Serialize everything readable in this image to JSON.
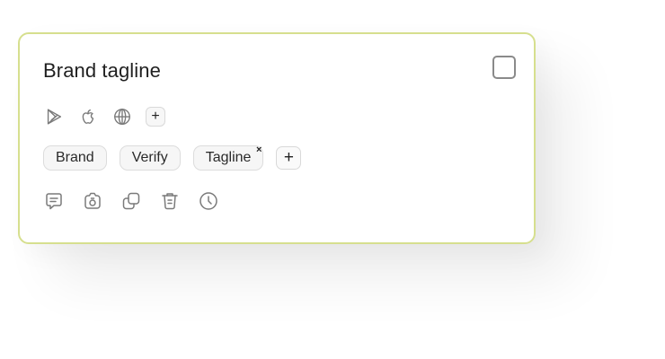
{
  "card": {
    "title": "Brand tagline",
    "border_color": "#d6df8e"
  },
  "platforms": [
    {
      "icon": "google-play-icon"
    },
    {
      "icon": "apple-icon"
    },
    {
      "icon": "globe-icon"
    }
  ],
  "platform_add_label": "+",
  "tags": [
    {
      "label": "Brand"
    },
    {
      "label": "Verify"
    },
    {
      "label": "Tagline",
      "remove_label": "×"
    }
  ],
  "tag_add_label": "+",
  "actions": [
    {
      "icon": "comment-icon"
    },
    {
      "icon": "screenshot-icon"
    },
    {
      "icon": "duplicate-icon"
    },
    {
      "icon": "delete-icon"
    },
    {
      "icon": "history-icon"
    }
  ]
}
